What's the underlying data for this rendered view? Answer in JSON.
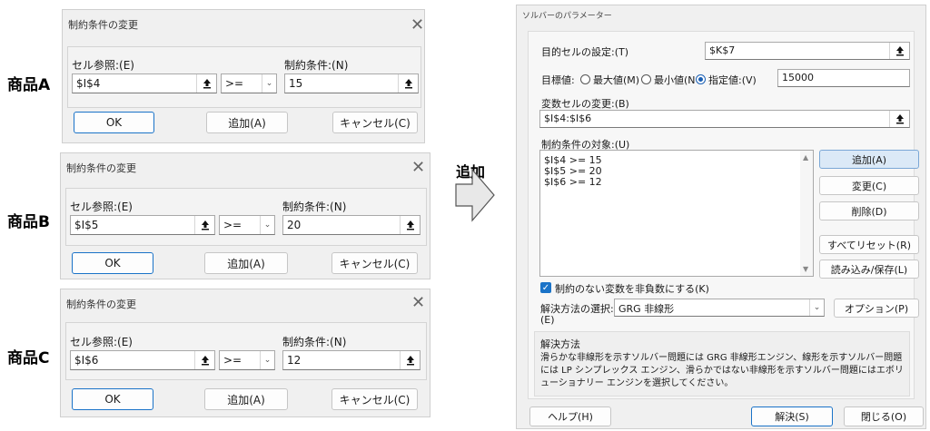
{
  "product_labels": [
    "商品A",
    "商品B",
    "商品C"
  ],
  "constraint_dialogs": [
    {
      "title": "制約条件の変更",
      "cell_ref_label": "セル参照:(E)",
      "cell_ref": "$I$4",
      "operator": ">=",
      "constraint_label": "制約条件:(N)",
      "constraint": "15",
      "ok": "OK",
      "add": "追加(A)",
      "cancel": "キャンセル(C)"
    },
    {
      "title": "制約条件の変更",
      "cell_ref_label": "セル参照:(E)",
      "cell_ref": "$I$5",
      "operator": ">=",
      "constraint_label": "制約条件:(N)",
      "constraint": "20",
      "ok": "OK",
      "add": "追加(A)",
      "cancel": "キャンセル(C)"
    },
    {
      "title": "制約条件の変更",
      "cell_ref_label": "セル参照:(E)",
      "cell_ref": "$I$6",
      "operator": ">=",
      "constraint_label": "制約条件:(N)",
      "constraint": "12",
      "ok": "OK",
      "add": "追加(A)",
      "cancel": "キャンセル(C)"
    }
  ],
  "arrow_label": "追加",
  "solver": {
    "title": "ソルバーのパラメーター",
    "objective_label": "目的セルの設定:(T)",
    "objective_value": "$K$7",
    "target_label": "目標値:",
    "opt_max": "最大値(M)",
    "opt_min": "最小値(N",
    "opt_value": "指定値:(V)",
    "target_value": "15000",
    "variable_label": "変数セルの変更:(B)",
    "variable_value": "$I$4:$I$6",
    "constraints_label": "制約条件の対象:(U)",
    "constraints": [
      "$I$4 >= 15",
      "$I$5 >= 20",
      "$I$6 >= 12"
    ],
    "btn_add": "追加(A)",
    "btn_change": "変更(C)",
    "btn_delete": "削除(D)",
    "btn_reset": "すべてリセット(R)",
    "btn_load_save": "読み込み/保存(L)",
    "nonneg_label": "制約のない変数を非負数にする(K)",
    "method_label_1": "解決方法の選択:",
    "method_label_2": "(E)",
    "method_value": "GRG 非線形",
    "btn_options": "オプション(P)",
    "method_title": "解決方法",
    "method_desc": "滑らかな非線形を示すソルバー問題には GRG 非線形エンジン、線形を示すソルバー問題には LP シンプレックス エンジン、滑らかではない非線形を示すソルバー問題にはエボリューショナリー エンジンを選択してください。",
    "btn_help": "ヘルプ(H)",
    "btn_solve": "解決(S)",
    "btn_close": "閉じる(O)"
  }
}
